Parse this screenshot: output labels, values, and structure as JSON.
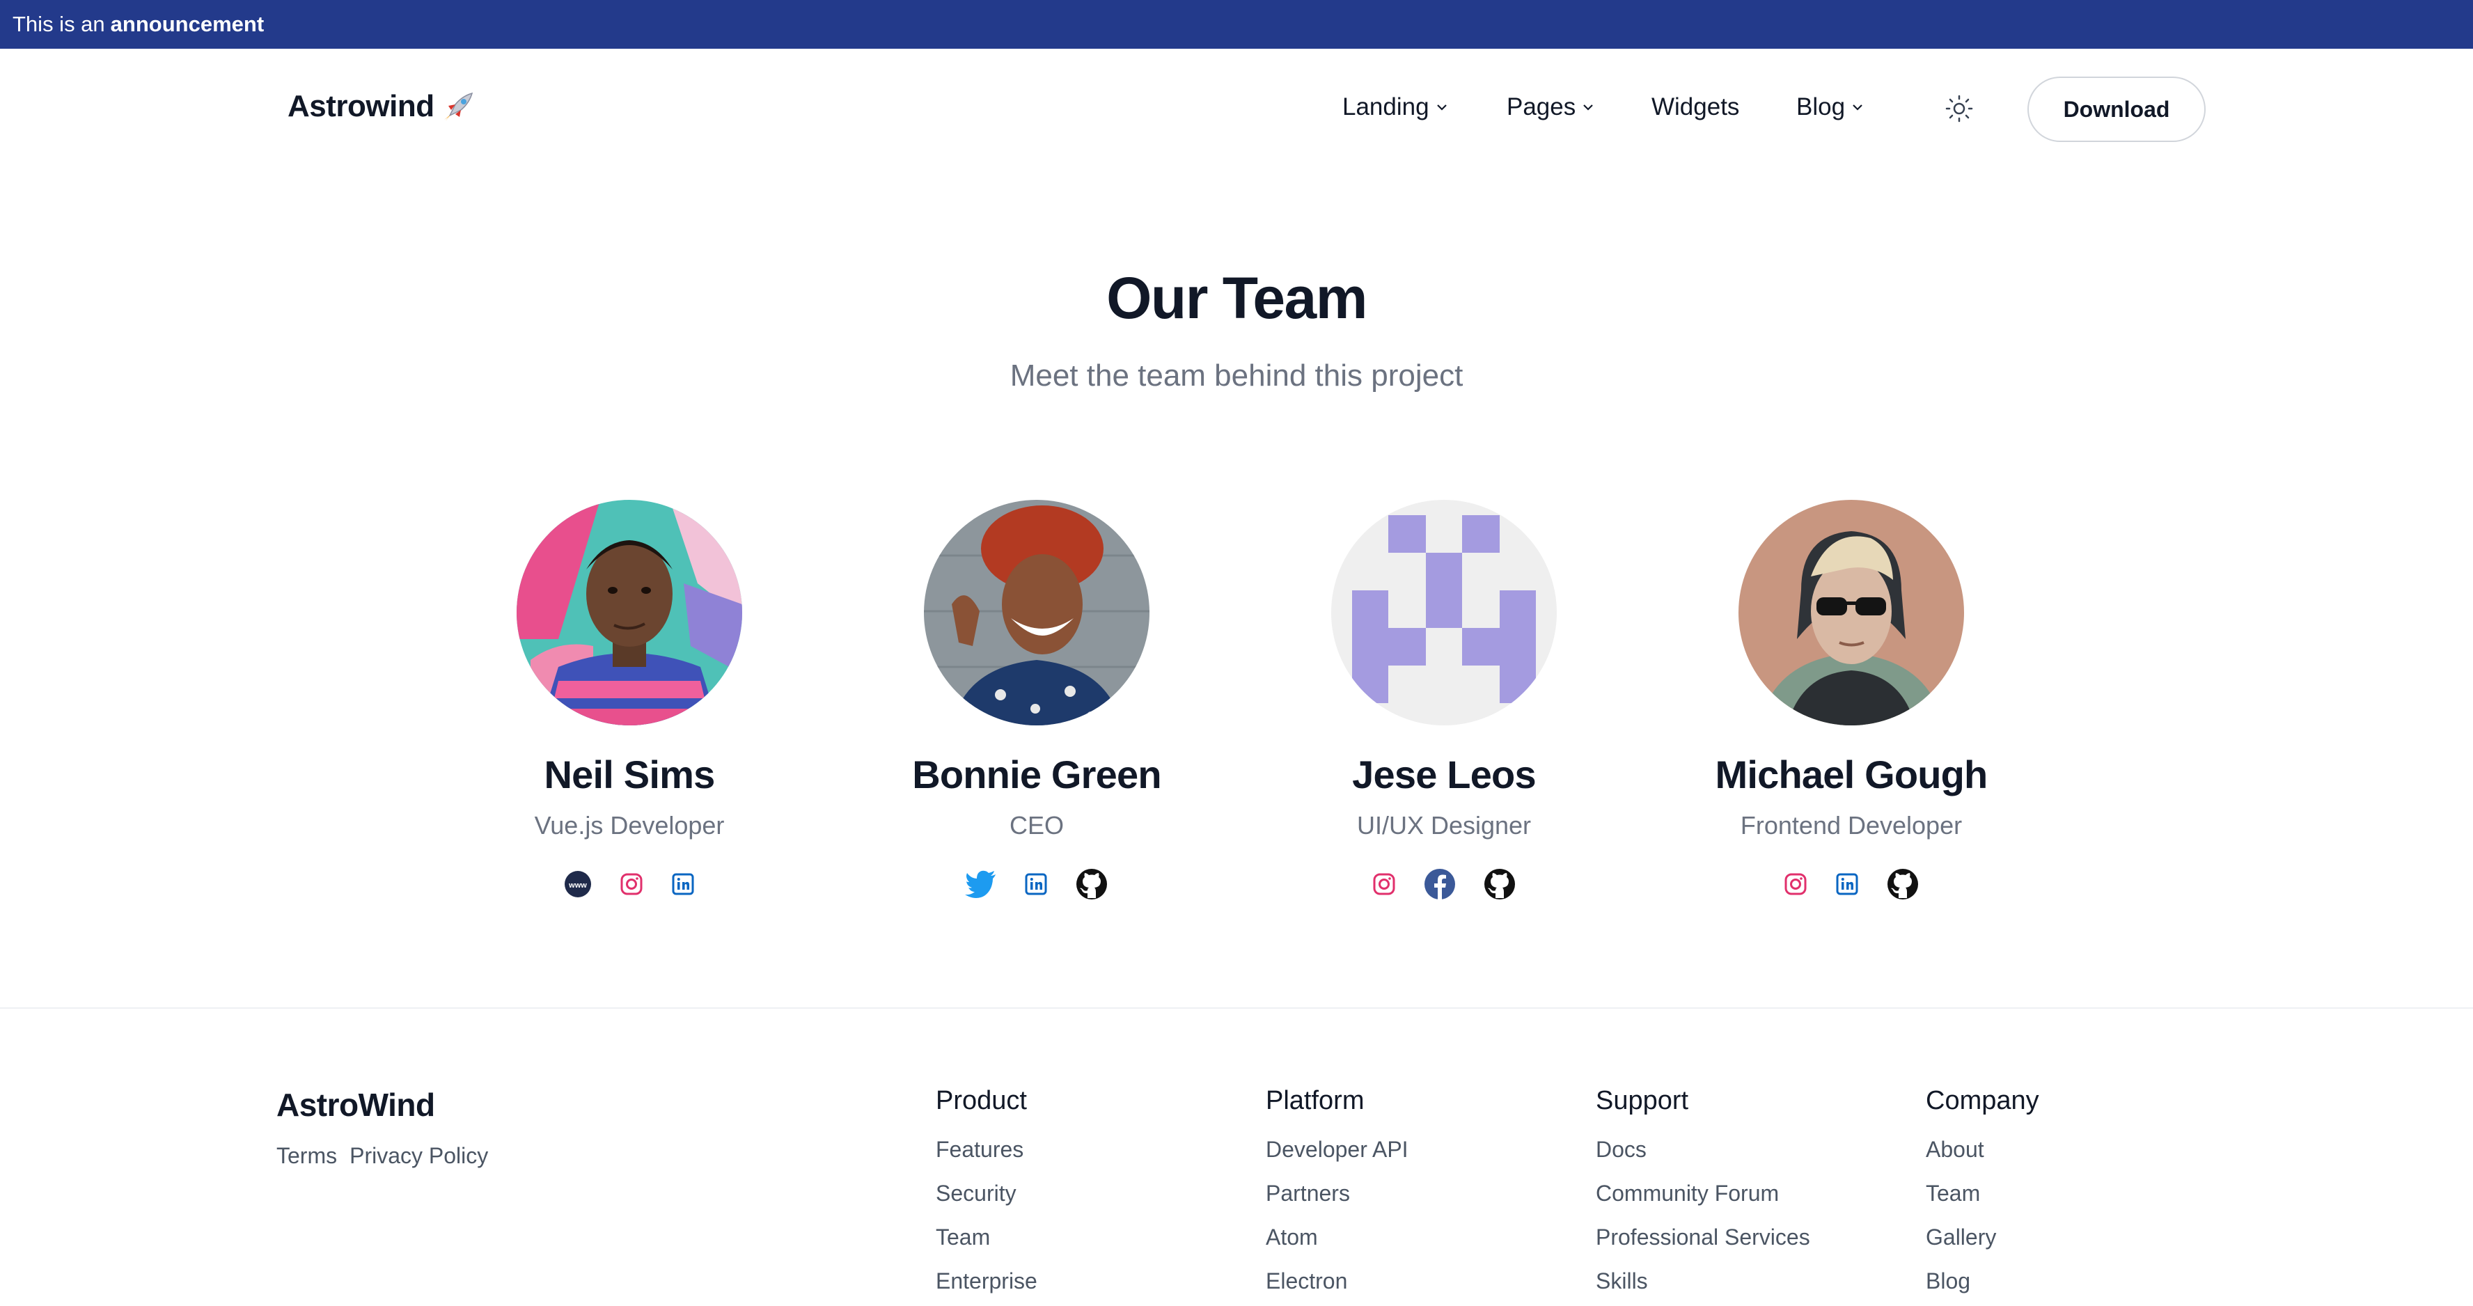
{
  "announcement": {
    "text": "This is an",
    "strong": "announcement"
  },
  "header": {
    "logo": "Astrowind",
    "nav": [
      {
        "label": "Landing",
        "dropdown": true
      },
      {
        "label": "Pages",
        "dropdown": true
      },
      {
        "label": "Widgets",
        "dropdown": false
      },
      {
        "label": "Blog",
        "dropdown": true
      }
    ],
    "theme_toggle_icon": "sun-icon",
    "download_label": "Download"
  },
  "team": {
    "title": "Our Team",
    "subtitle": "Meet the team behind this project",
    "members": [
      {
        "name": "Neil Sims",
        "role": "Vue.js Developer",
        "socials": [
          "www-icon",
          "instagram-icon",
          "linkedin-icon"
        ]
      },
      {
        "name": "Bonnie Green",
        "role": "CEO",
        "socials": [
          "twitter-icon",
          "linkedin-icon",
          "github-icon"
        ]
      },
      {
        "name": "Jese Leos",
        "role": "UI/UX Designer",
        "socials": [
          "instagram-icon",
          "facebook-icon",
          "github-icon"
        ]
      },
      {
        "name": "Michael Gough",
        "role": "Frontend Developer",
        "socials": [
          "instagram-icon",
          "linkedin-icon",
          "github-icon"
        ]
      }
    ]
  },
  "footer": {
    "brand": "AstroWind",
    "legal": [
      "Terms",
      "Privacy Policy"
    ],
    "columns": [
      {
        "title": "Product",
        "links": [
          "Features",
          "Security",
          "Team",
          "Enterprise"
        ]
      },
      {
        "title": "Platform",
        "links": [
          "Developer API",
          "Partners",
          "Atom",
          "Electron"
        ]
      },
      {
        "title": "Support",
        "links": [
          "Docs",
          "Community Forum",
          "Professional Services",
          "Skills"
        ]
      },
      {
        "title": "Company",
        "links": [
          "About",
          "Team",
          "Gallery",
          "Blog"
        ]
      }
    ]
  },
  "colors": {
    "announcement_bg": "#233a8b",
    "twitter": "#1d9bf0",
    "instagram": "#e1306c",
    "linkedin": "#0a66c2",
    "facebook": "#1877f2",
    "avatar_pattern": "#a49be0"
  }
}
